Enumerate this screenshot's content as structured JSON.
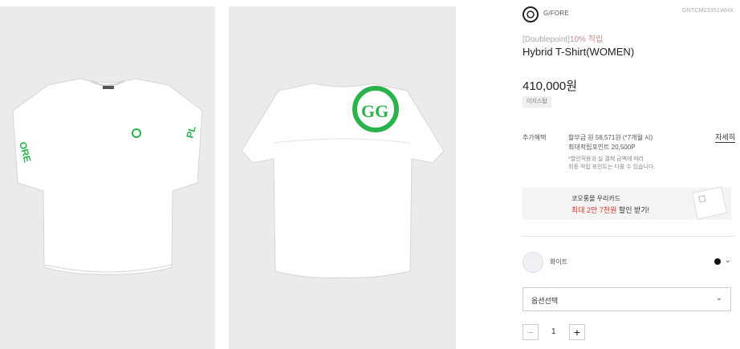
{
  "product": {
    "brand": "G/FORE",
    "sku": "GNTCM23351WHX",
    "promo_prefix": "[Doublepoint]",
    "promo_points": "10% 적립",
    "title": "Hybrid T-Shirt(WOMEN)",
    "price": "410,000원",
    "tag": "이지스탑"
  },
  "benefits": {
    "label": "추가혜택",
    "line1": "할부금 원 58,571원 (*7개월 시)",
    "line2": "최대적립포인트 20,500P",
    "note1": "*할인적용과 실 결제 금액에 따라",
    "note2": "최종 적립 포인트는 다를 수 있습니다.",
    "detail_link": "자세히"
  },
  "card_banner": {
    "line1": "코오롱몰 우리카드",
    "line2_red": "최대 2만 7천원",
    "line2_rest": " 할인 받기!"
  },
  "color_option": {
    "name": "화이트",
    "swatch_color": "#f0f1f4",
    "chevron": "⌄"
  },
  "option_select": {
    "label": "옵션선택",
    "chevron": "⌄"
  },
  "quantity": {
    "minus": "−",
    "value": "1",
    "plus": "+"
  },
  "images": {
    "front_print_text": "PL ORE",
    "shirt_color": "#ffffff",
    "accent_green": "#2bb24c"
  }
}
